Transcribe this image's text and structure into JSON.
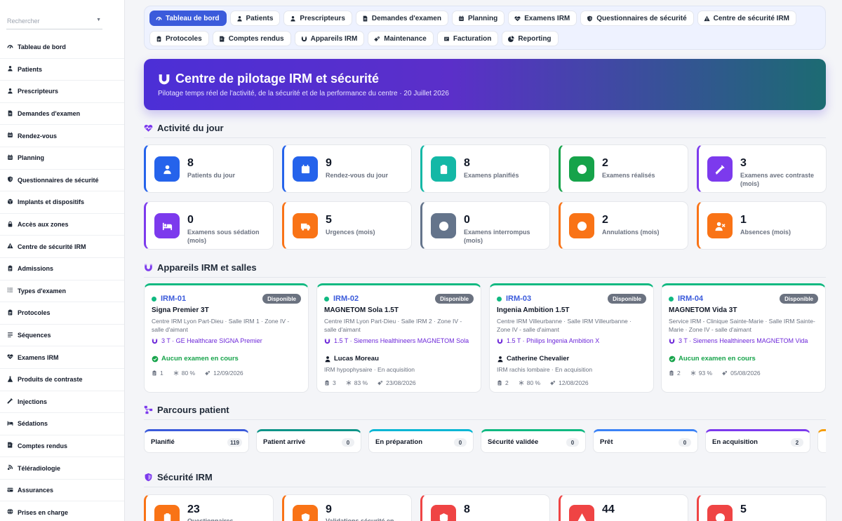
{
  "search": {
    "placeholder": "Rechercher"
  },
  "sidebar": {
    "items": [
      {
        "label": "Tableau de bord",
        "icon": "gauge-icon"
      },
      {
        "label": "Patients",
        "icon": "user-icon"
      },
      {
        "label": "Prescripteurs",
        "icon": "user-icon"
      },
      {
        "label": "Demandes d'examen",
        "icon": "document-icon"
      },
      {
        "label": "Rendez-vous",
        "icon": "calendar-icon"
      },
      {
        "label": "Planning",
        "icon": "calendar-icon"
      },
      {
        "label": "Questionnaires de sécurité",
        "icon": "shield-icon"
      },
      {
        "label": "Implants et dispositifs",
        "icon": "cube-icon"
      },
      {
        "label": "Accès aux zones",
        "icon": "lock-icon"
      },
      {
        "label": "Centre de sécurité IRM",
        "icon": "warning-icon"
      },
      {
        "label": "Admissions",
        "icon": "clipboard-icon"
      },
      {
        "label": "Types d'examen",
        "icon": "list-icon"
      },
      {
        "label": "Protocoles",
        "icon": "clipboard-icon"
      },
      {
        "label": "Séquences",
        "icon": "sequence-icon"
      },
      {
        "label": "Examens IRM",
        "icon": "heart-pulse-icon"
      },
      {
        "label": "Produits de contraste",
        "icon": "flask-icon"
      },
      {
        "label": "Injections",
        "icon": "syringe-icon"
      },
      {
        "label": "Sédations",
        "icon": "bed-icon"
      },
      {
        "label": "Comptes rendus",
        "icon": "report-icon"
      },
      {
        "label": "Téléradiologie",
        "icon": "satellite-icon"
      },
      {
        "label": "Assurances",
        "icon": "card-icon"
      },
      {
        "label": "Prises en charge",
        "icon": "globe-icon"
      }
    ]
  },
  "topnav": {
    "row1": [
      {
        "label": "Tableau de bord",
        "icon": "gauge-icon",
        "active": true
      },
      {
        "label": "Patients",
        "icon": "user-icon"
      },
      {
        "label": "Prescripteurs",
        "icon": "user-icon"
      },
      {
        "label": "Demandes d'examen",
        "icon": "document-icon"
      },
      {
        "label": "Planning",
        "icon": "calendar-icon"
      },
      {
        "label": "Examens IRM",
        "icon": "heart-pulse-icon"
      },
      {
        "label": "Questionnaires de sécurité",
        "icon": "shield-icon"
      },
      {
        "label": "Centre de sécurité IRM",
        "icon": "warning-icon"
      }
    ],
    "row2": [
      {
        "label": "Protocoles",
        "icon": "clipboard-icon"
      },
      {
        "label": "Comptes rendus",
        "icon": "report-icon"
      },
      {
        "label": "Appareils IRM",
        "icon": "magnet-icon"
      },
      {
        "label": "Maintenance",
        "icon": "cogs-icon"
      },
      {
        "label": "Facturation",
        "icon": "invoice-icon"
      },
      {
        "label": "Reporting",
        "icon": "chart-pie-icon"
      }
    ]
  },
  "hero": {
    "title": "Centre de pilotage IRM et sécurité",
    "subtitle": "Pilotage temps réel de l'activité, de la sécurité et de la performance du centre · 20 Juillet 2026"
  },
  "activity": {
    "title": "Activité du jour",
    "cards": [
      {
        "value": "8",
        "label": "Patients du jour",
        "icon": "user-icon",
        "color": "#2563eb"
      },
      {
        "value": "9",
        "label": "Rendez-vous du jour",
        "icon": "calendar-icon",
        "color": "#2563eb"
      },
      {
        "value": "8",
        "label": "Examens planifiés",
        "icon": "clipboard-icon",
        "color": "#14b8a6"
      },
      {
        "value": "2",
        "label": "Examens réalisés",
        "icon": "check-circle-icon",
        "color": "#16a34a"
      },
      {
        "value": "3",
        "label": "Examens avec contraste (mois)",
        "icon": "syringe-icon",
        "color": "#7c3aed"
      },
      {
        "value": "0",
        "label": "Examens sous sédation (mois)",
        "icon": "bed-icon",
        "color": "#7c3aed"
      },
      {
        "value": "5",
        "label": "Urgences (mois)",
        "icon": "ambulance-icon",
        "color": "#f97316"
      },
      {
        "value": "0",
        "label": "Examens interrompus (mois)",
        "icon": "alert-circle-icon",
        "color": "#64748b"
      },
      {
        "value": "2",
        "label": "Annulations (mois)",
        "icon": "x-circle-icon",
        "color": "#f97316"
      },
      {
        "value": "1",
        "label": "Absences (mois)",
        "icon": "user-x-icon",
        "color": "#f97316"
      }
    ]
  },
  "devices": {
    "title": "Appareils IRM et salles",
    "items": [
      {
        "code": "IRM-01",
        "badge": "Disponible",
        "name": "Signa Premier 3T",
        "location": "Centre IRM Lyon Part-Dieu · Salle IRM 1 · Zone IV - salle d'aimant",
        "spec": "3 T · GE Healthcare SIGNA Premier",
        "status": "Aucun examen en cours",
        "patient": "",
        "patient_detail": "",
        "count": "1",
        "helium": "80 %",
        "date": "12/09/2026"
      },
      {
        "code": "IRM-02",
        "badge": "Disponible",
        "name": "MAGNETOM Sola 1.5T",
        "location": "Centre IRM Lyon Part-Dieu · Salle IRM 2 · Zone IV - salle d'aimant",
        "spec": "1.5 T · Siemens Healthineers MAGNETOM Sola",
        "status": "",
        "patient": "Lucas Moreau",
        "patient_detail": "IRM hypophysaire · En acquisition",
        "count": "3",
        "helium": "83 %",
        "date": "23/08/2026"
      },
      {
        "code": "IRM-03",
        "badge": "Disponible",
        "name": "Ingenia Ambition 1.5T",
        "location": "Centre IRM Villeurbanne · Salle IRM Villeurbanne · Zone IV - salle d'aimant",
        "spec": "1.5 T · Philips Ingenia Ambition X",
        "status": "",
        "patient": "Catherine Chevalier",
        "patient_detail": "IRM rachis lombaire · En acquisition",
        "count": "2",
        "helium": "80 %",
        "date": "12/08/2026"
      },
      {
        "code": "IRM-04",
        "badge": "Disponible",
        "name": "MAGNETOM Vida 3T",
        "location": "Service IRM - Clinique Sainte-Marie · Salle IRM Sainte-Marie · Zone IV - salle d'aimant",
        "spec": "3 T · Siemens Healthineers MAGNETOM Vida",
        "status": "Aucun examen en cours",
        "patient": "",
        "patient_detail": "",
        "count": "2",
        "helium": "93 %",
        "date": "05/08/2026"
      }
    ]
  },
  "pathway": {
    "title": "Parcours patient",
    "steps": [
      {
        "label": "Planifié",
        "count": "119",
        "color": "#3b5bdb"
      },
      {
        "label": "Patient arrivé",
        "count": "0",
        "color": "#0d9488"
      },
      {
        "label": "En préparation",
        "count": "0",
        "color": "#06b6d4"
      },
      {
        "label": "Sécurité validée",
        "count": "0",
        "color": "#10b981"
      },
      {
        "label": "Prêt",
        "count": "0",
        "color": "#3b82f6"
      },
      {
        "label": "En acquisition",
        "count": "2",
        "color": "#7c3aed"
      },
      {
        "label": "",
        "count": "",
        "color": "#f59e0b"
      }
    ]
  },
  "safety": {
    "title": "Sécurité IRM",
    "cards": [
      {
        "value": "23",
        "label": "Questionnaires",
        "icon": "clipboard-icon",
        "color": "#f97316"
      },
      {
        "value": "9",
        "label": "Validations sécurité en",
        "icon": "shield-icon",
        "color": "#f97316"
      },
      {
        "value": "8",
        "label": "",
        "icon": "cube-icon",
        "color": "#ef4444"
      },
      {
        "value": "44",
        "label": "",
        "icon": "warning-icon",
        "color": "#ef4444"
      },
      {
        "value": "5",
        "label": "",
        "icon": "ban-icon",
        "color": "#ef4444"
      }
    ]
  }
}
